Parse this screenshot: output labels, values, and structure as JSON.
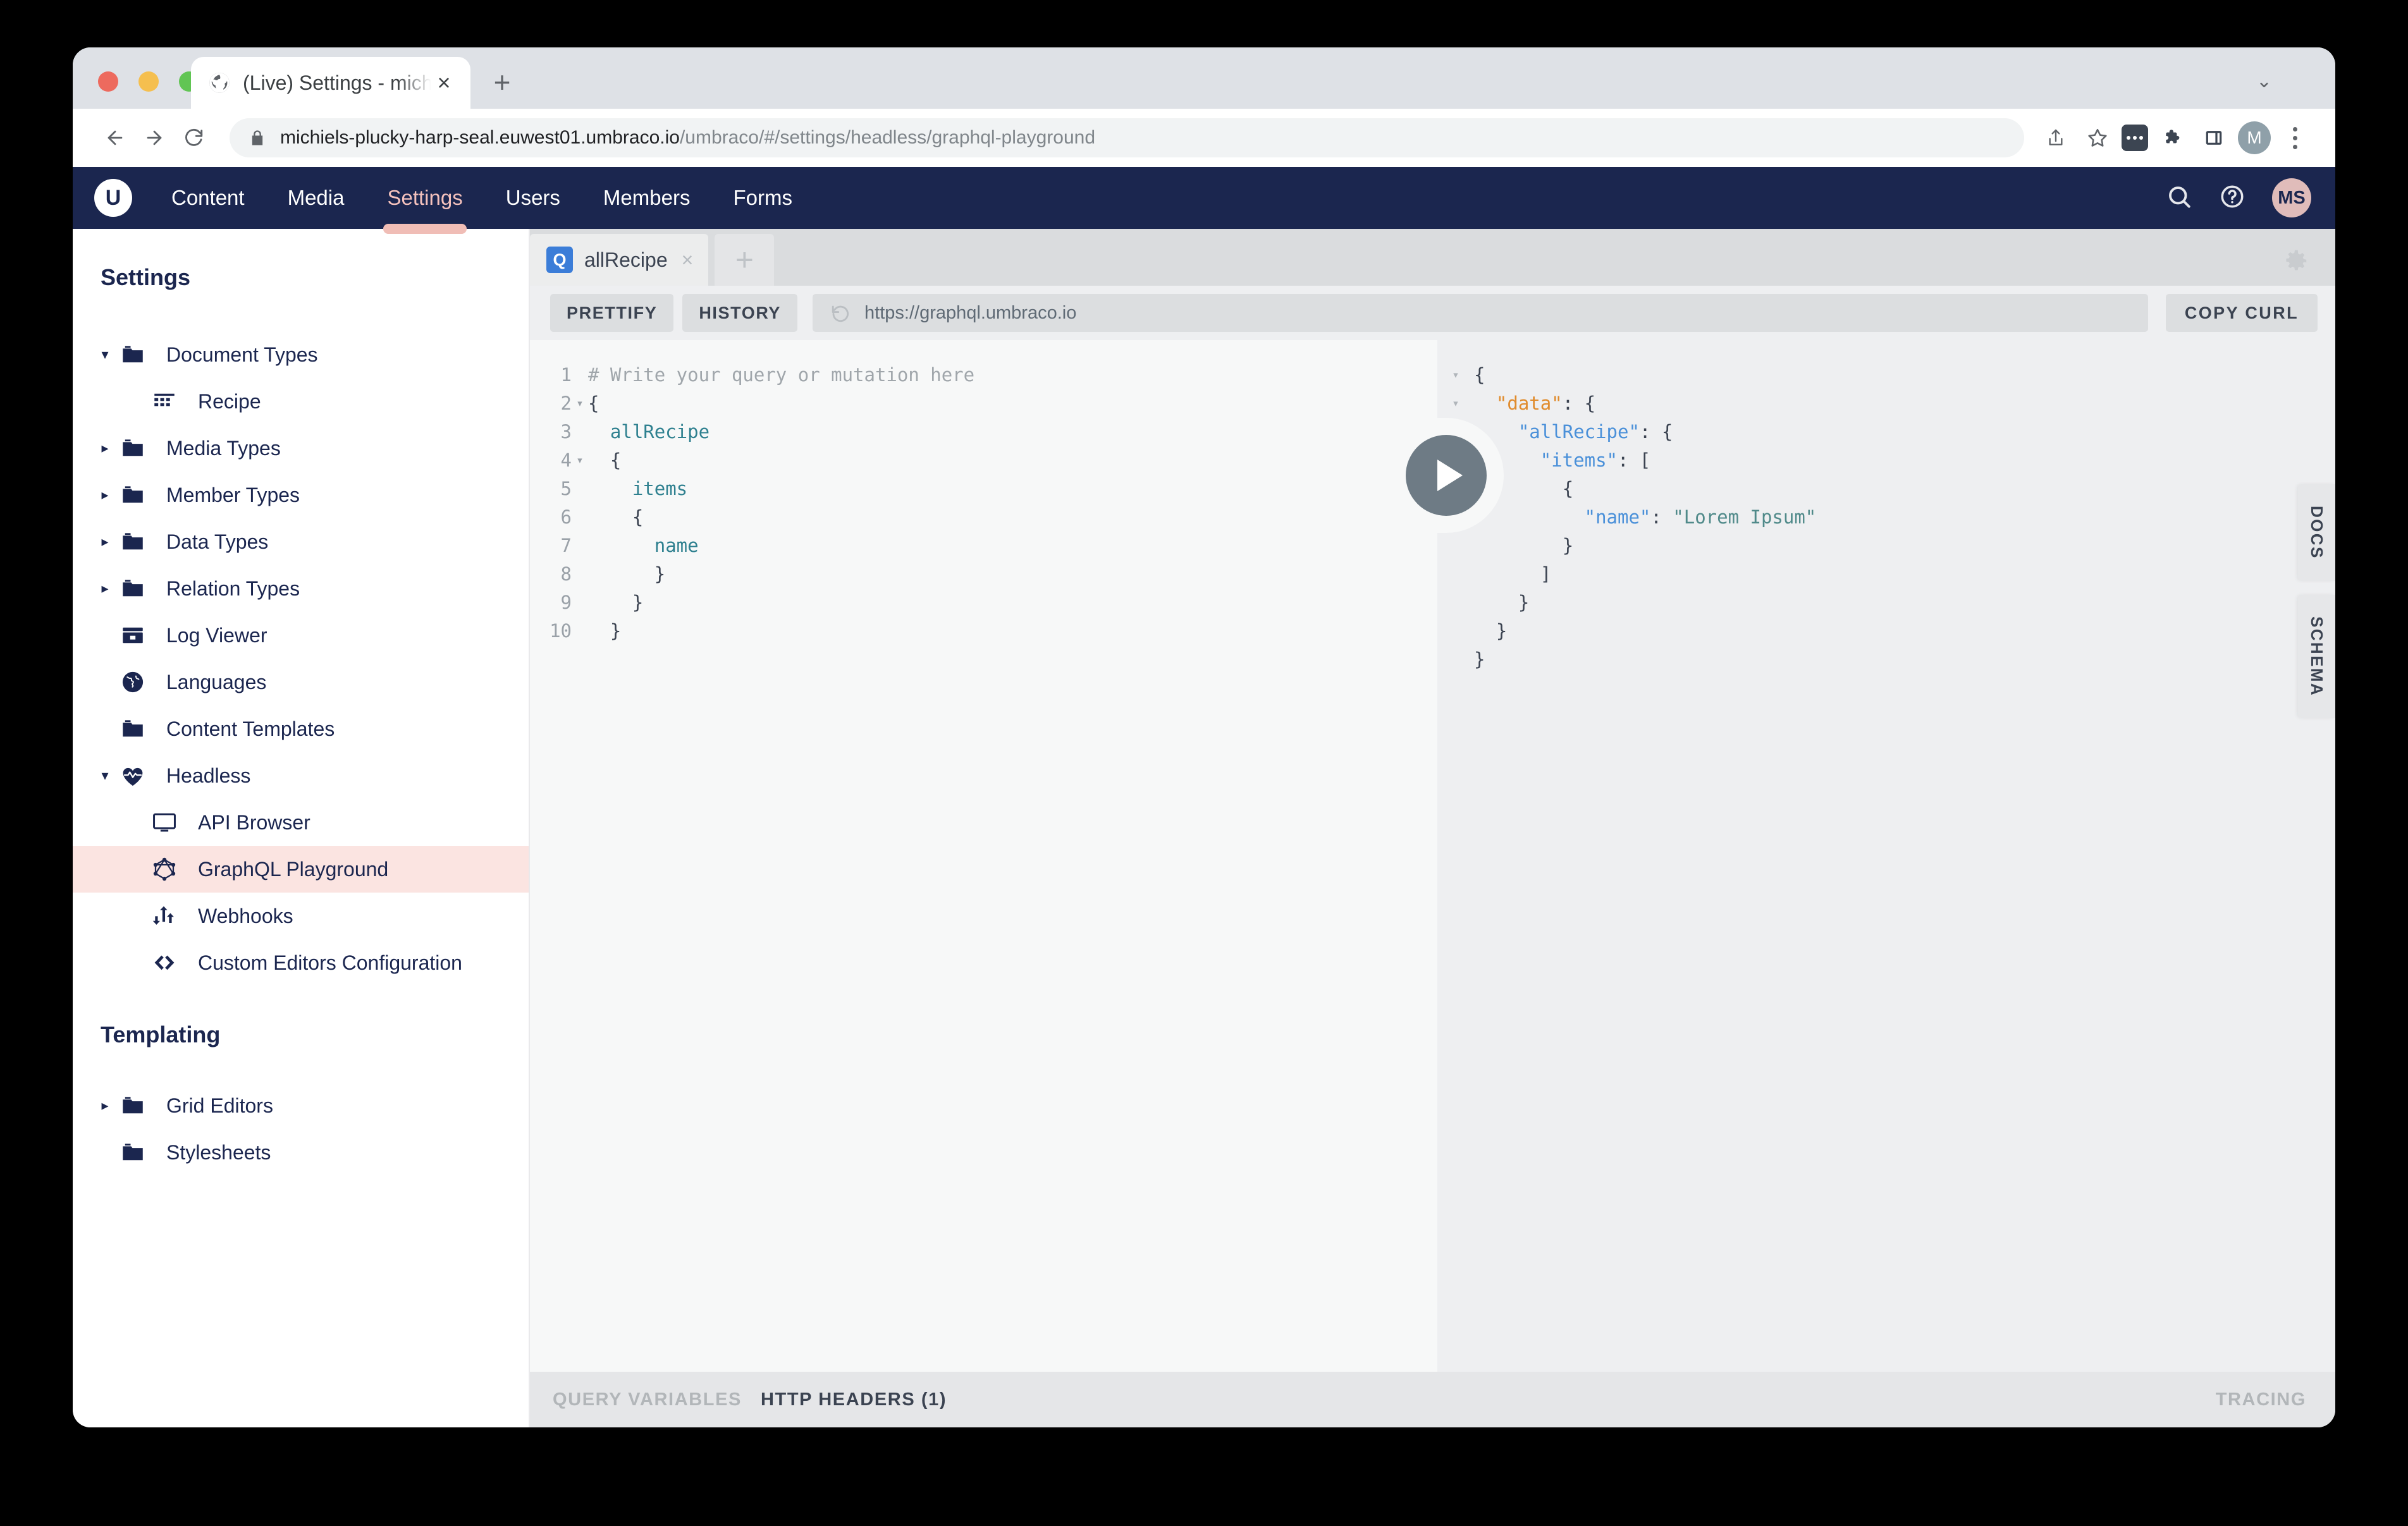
{
  "browser": {
    "tab": {
      "title": "(Live) Settings - michiels-pluck",
      "favicon_name": "globe-icon",
      "close_label": "×"
    },
    "newtab_label": "+",
    "window_caret": "⌄",
    "url_host": "michiels-plucky-harp-seal.euwest01.umbraco.io",
    "url_path": "/umbraco/#/settings/headless/graphql-playground",
    "toolbar_icons": [
      "share-icon",
      "bookmark-star-icon",
      "extension-badge-icon",
      "puzzle-icon",
      "side-panel-icon",
      "profile-avatar",
      "kebab-menu-icon"
    ],
    "profile_initial": "M"
  },
  "umbraco": {
    "logo_letter": "U",
    "nav": [
      {
        "label": "Content",
        "active": false
      },
      {
        "label": "Media",
        "active": false
      },
      {
        "label": "Settings",
        "active": true
      },
      {
        "label": "Users",
        "active": false
      },
      {
        "label": "Members",
        "active": false
      },
      {
        "label": "Forms",
        "active": false
      }
    ],
    "header_icons": [
      "search-icon",
      "help-icon"
    ],
    "user_initials": "MS",
    "accent": "#f0bdb6",
    "header_bg": "#1b264f"
  },
  "tree": {
    "title": "Settings",
    "group_title": "Templating",
    "items": [
      {
        "label": "Document Types",
        "icon": "folder-icon",
        "caret": "down",
        "indent": false,
        "selected": false
      },
      {
        "label": "Recipe",
        "icon": "document-type-icon",
        "caret": "none",
        "indent": true,
        "selected": false
      },
      {
        "label": "Media Types",
        "icon": "folder-icon",
        "caret": "right",
        "indent": false,
        "selected": false
      },
      {
        "label": "Member Types",
        "icon": "folder-icon",
        "caret": "right",
        "indent": false,
        "selected": false
      },
      {
        "label": "Data Types",
        "icon": "folder-icon",
        "caret": "right",
        "indent": false,
        "selected": false
      },
      {
        "label": "Relation Types",
        "icon": "folder-icon",
        "caret": "right",
        "indent": false,
        "selected": false
      },
      {
        "label": "Log Viewer",
        "icon": "log-viewer-icon",
        "caret": "none",
        "indent": false,
        "selected": false
      },
      {
        "label": "Languages",
        "icon": "globe-icon",
        "caret": "none",
        "indent": false,
        "selected": false
      },
      {
        "label": "Content Templates",
        "icon": "folder-icon",
        "caret": "none",
        "indent": false,
        "selected": false
      },
      {
        "label": "Headless",
        "icon": "heartbeat-icon",
        "caret": "down",
        "indent": false,
        "selected": false
      },
      {
        "label": "API Browser",
        "icon": "monitor-icon",
        "caret": "none",
        "indent": true,
        "selected": false
      },
      {
        "label": "GraphQL Playground",
        "icon": "graphql-icon",
        "caret": "none",
        "indent": true,
        "selected": true
      },
      {
        "label": "Webhooks",
        "icon": "webhook-icon",
        "caret": "none",
        "indent": true,
        "selected": false
      },
      {
        "label": "Custom Editors Configuration",
        "icon": "code-brackets-icon",
        "caret": "none",
        "indent": true,
        "selected": false
      }
    ],
    "group_items": [
      {
        "label": "Grid Editors",
        "icon": "folder-icon",
        "caret": "right",
        "indent": false,
        "selected": false
      },
      {
        "label": "Stylesheets",
        "icon": "folder-icon",
        "caret": "none",
        "indent": false,
        "selected": false
      }
    ],
    "selected_bg": "#fbe4e1"
  },
  "playground": {
    "tab": {
      "badge": "Q",
      "name": "allRecipe",
      "close": "×"
    },
    "newtab_label": "+",
    "gear_name": "gear-icon",
    "toolbar": {
      "prettify": "PRETTIFY",
      "history": "HISTORY",
      "endpoint": "https://graphql.umbraco.io",
      "copy_curl": "COPY CURL"
    },
    "editor": {
      "lines": [
        {
          "n": "1",
          "fold": "",
          "text": "# Write your query or mutation here",
          "cls": "c-comment"
        },
        {
          "n": "2",
          "fold": "▾",
          "text": "{",
          "cls": "c-punct"
        },
        {
          "n": "3",
          "fold": "",
          "text": "  allRecipe",
          "cls": "c-field"
        },
        {
          "n": "4",
          "fold": "▾",
          "text": "  {",
          "cls": "c-punct"
        },
        {
          "n": "5",
          "fold": "",
          "text": "    items",
          "cls": "c-field"
        },
        {
          "n": "6",
          "fold": "",
          "text": "    {",
          "cls": "c-punct"
        },
        {
          "n": "7",
          "fold": "",
          "text": "      name",
          "cls": "c-field"
        },
        {
          "n": "8",
          "fold": "",
          "text": "      }",
          "cls": "c-punct"
        },
        {
          "n": "9",
          "fold": "",
          "text": "    }",
          "cls": "c-punct"
        },
        {
          "n": "10",
          "fold": "",
          "text": "  }",
          "cls": "c-punct"
        }
      ]
    },
    "play_button_name": "execute-query-button",
    "result": {
      "lines": [
        {
          "fold": "▾",
          "indent": 0,
          "parts": [
            {
              "t": "{",
              "c": "j-punct"
            }
          ]
        },
        {
          "fold": "▾",
          "indent": 1,
          "parts": [
            {
              "t": "\"data\"",
              "c": "j-key-orange"
            },
            {
              "t": ": {",
              "c": "j-punct"
            }
          ]
        },
        {
          "fold": "▾",
          "indent": 2,
          "parts": [
            {
              "t": "\"allRecipe\"",
              "c": "j-key-blue"
            },
            {
              "t": ": {",
              "c": "j-punct"
            }
          ]
        },
        {
          "fold": "▾",
          "indent": 3,
          "parts": [
            {
              "t": "\"items\"",
              "c": "j-key-blue"
            },
            {
              "t": ": [",
              "c": "j-punct"
            }
          ]
        },
        {
          "fold": "",
          "indent": 4,
          "parts": [
            {
              "t": "{",
              "c": "j-punct"
            }
          ]
        },
        {
          "fold": "",
          "indent": 5,
          "parts": [
            {
              "t": "\"name\"",
              "c": "j-key-blue"
            },
            {
              "t": ": ",
              "c": "j-punct"
            },
            {
              "t": "\"Lorem Ipsum\"",
              "c": "j-str"
            }
          ]
        },
        {
          "fold": "",
          "indent": 4,
          "parts": [
            {
              "t": "}",
              "c": "j-punct"
            }
          ]
        },
        {
          "fold": "",
          "indent": 3,
          "parts": [
            {
              "t": "]",
              "c": "j-punct"
            }
          ]
        },
        {
          "fold": "",
          "indent": 2,
          "parts": [
            {
              "t": "}",
              "c": "j-punct"
            }
          ]
        },
        {
          "fold": "",
          "indent": 1,
          "parts": [
            {
              "t": "}",
              "c": "j-punct"
            }
          ]
        },
        {
          "fold": "",
          "indent": 0,
          "parts": [
            {
              "t": "}",
              "c": "j-punct"
            }
          ]
        }
      ]
    },
    "side_tabs": [
      "DOCS",
      "SCHEMA"
    ],
    "footer": {
      "query_variables": "QUERY VARIABLES",
      "http_headers": "HTTP HEADERS (1)",
      "tracing": "TRACING"
    }
  }
}
